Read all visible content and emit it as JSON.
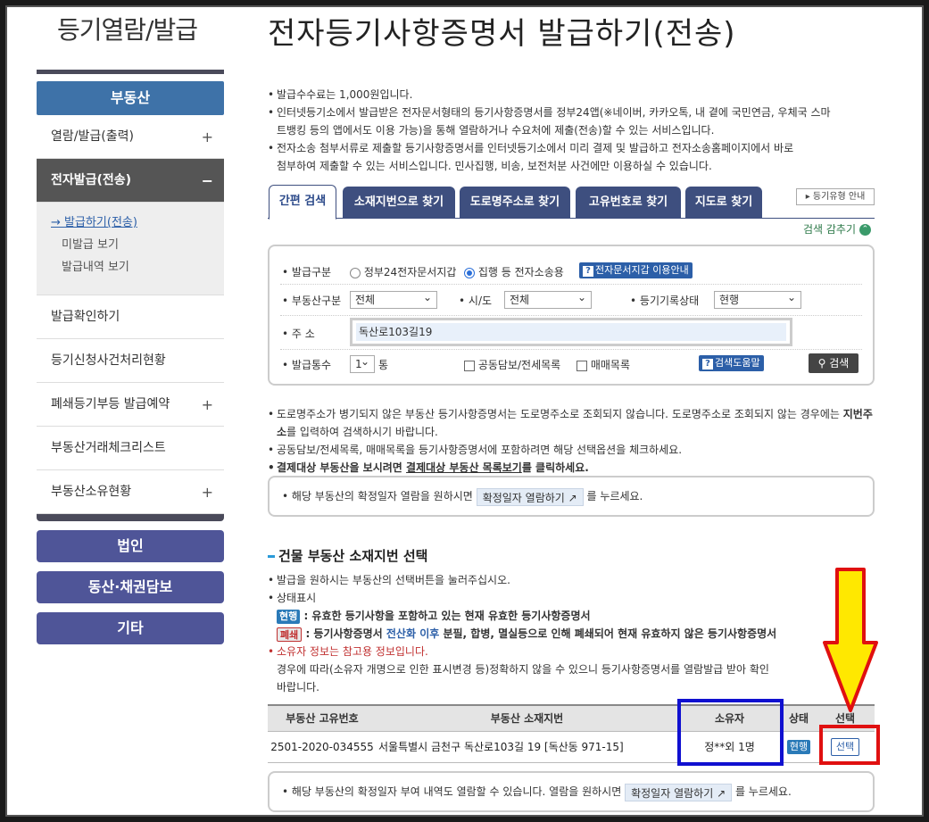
{
  "section_title": "등기열람/발급",
  "main_title": "전자등기사항증명서 발급하기(전송)",
  "sidebar": {
    "header": "부동산",
    "items": [
      {
        "label": "열람/발급(출력)",
        "toggle": "+"
      },
      {
        "label": "전자발급(전송)",
        "toggle": "−"
      },
      {
        "label": "발급확인하기",
        "toggle": ""
      },
      {
        "label": "등기신청사건처리현황",
        "toggle": ""
      },
      {
        "label": "폐쇄등기부등 발급예약",
        "toggle": "+"
      },
      {
        "label": "부동산거래체크리스트",
        "toggle": ""
      },
      {
        "label": "부동산소유현황",
        "toggle": "+"
      }
    ],
    "sub_items": [
      "발급하기(전송)",
      "미발급 보기",
      "발급내역 보기"
    ],
    "buttons": [
      "법인",
      "동산·채권담보",
      "기타"
    ]
  },
  "notes": [
    "발급수수료는 1,000원입니다.",
    "인터넷등기소에서 발급받은 전자문서형태의 등기사항증명서를 정부24앱(※네이버, 카카오톡, 내 곁에 국민연금, 우체국 스마",
    "트뱅킹 등의 앱에서도 이용 가능)을 통해 열람하거나 수요처에 제출(전송)할 수 있는 서비스입니다.",
    "전자소송 첨부서류로 제출할 등기사항증명서를 인터넷등기소에서 미리 결제 및 발급하고 전자소송홈페이지에서 바로",
    "첨부하여 제출할 수 있는 서비스입니다. 민사집행, 비송, 보전처분 사건에만 이용하실 수 있습니다."
  ],
  "tabs": [
    "간편 검색",
    "소재지번으로 찾기",
    "도로명주소로 찾기",
    "고유번호로 찾기",
    "지도로 찾기"
  ],
  "guide_button": "등기유형 안내",
  "hide_search": "검색 감추기",
  "search": {
    "issue_type_label": "발급구분",
    "radio1": "정부24전자문서지갑",
    "radio2": "집행 등 전자소송용",
    "wallet_help": "전자문서지갑 이용안내",
    "property_type_label": "부동산구분",
    "property_type_value": "전체",
    "region_label": "시/도",
    "region_value": "전체",
    "record_status_label": "등기기록상태",
    "record_status_value": "현행",
    "address_label": "주 소",
    "address_value": "독산로103길19",
    "copies_label": "발급통수",
    "copies_value": "1",
    "copies_unit": "통",
    "check1": "공동담보/전세목록",
    "check2": "매매목록",
    "search_help": "검색도움말",
    "search_button": "검색"
  },
  "notes2": {
    "n1a": "도로명주소가 병기되지 않은 부동산 등기사항증명서는 도로명주소로 조회되지 않습니다. 도로명주소로 조회되지 않는 경우에는",
    "n1b": "지번주소",
    "n1c": "를 입력하여 검색하시기 바랍니다.",
    "n2": "공동담보/전세목록, 매매목록을 등기사항증명서에 포함하려면 해당 선택옵션을 체크하세요.",
    "n3a": "결제대상 부동산을 보시려면",
    "n3b": "결제대상 부동산 목록보기",
    "n3c": "를 클릭하세요."
  },
  "info1": {
    "text_before": "해당 부동산의 확정일자 열람을 원하시면",
    "button": "확정일자 열람하기",
    "text_after": "를 누르세요."
  },
  "result": {
    "title": "건물 부동산 소재지번 선택",
    "n1": "발급을 원하시는 부동산의 선택버튼을 눌러주십시오.",
    "n2": "상태표시",
    "badge_current": "현행",
    "badge_current_desc": ": 유효한 등기사항을 포함하고 있는 현재 유효한 등기사항증명서",
    "badge_closed": "폐쇄",
    "badge_closed_desc_a": ": 등기사항증명서",
    "badge_closed_desc_b": "전산화 이후",
    "badge_closed_desc_c": "분필, 합병, 멸실등으로 인해 폐쇄되어 현재 유효하지 않은 등기사항증명서",
    "warn": "소유자 정보는 참고용 정보입니다.",
    "warn2": "경우에 따라(소유자 개명으로 인한 표시변경 등)정확하지 않을 수 있으니 등기사항증명서를 열람발급 받아 확인",
    "warn3": "바랍니다."
  },
  "table": {
    "headers": [
      "부동산 고유번호",
      "부동산 소재지번",
      "소유자",
      "상태",
      "선택"
    ],
    "rows": [
      {
        "id": "2501-2020-034555",
        "address": "서울특별시 금천구 독산로103길 19 [독산동 971-15]",
        "owner": "정**외 1명",
        "status": "현행",
        "select": "선택"
      }
    ]
  },
  "info2": {
    "text_before": "해당 부동산의 확정일자 부여 내역도 열람할 수 있습니다. 열람을 원하시면",
    "button": "확정일자 열람하기",
    "text_after": "를 누르세요."
  },
  "colors": {
    "blue_nav": "#3e72a8",
    "tab": "#3e4f7f",
    "annot_blue": "#1010d0",
    "annot_red": "#e01010",
    "annot_yellow": "#ffe800"
  }
}
